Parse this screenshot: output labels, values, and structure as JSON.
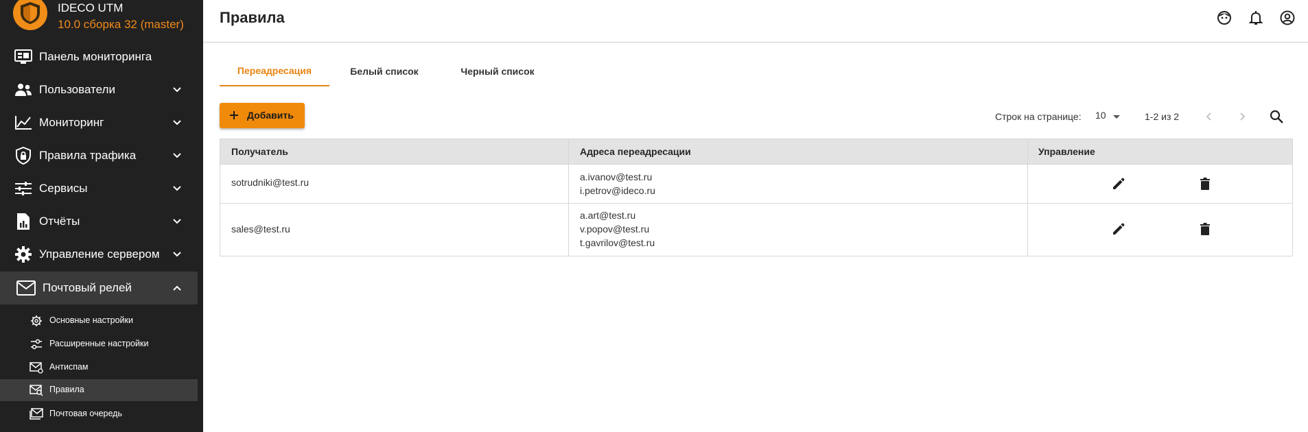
{
  "brand": {
    "name": "IDECO UTM",
    "version": "10.0 сборка 32 (master)"
  },
  "sidebar": {
    "items": [
      {
        "label": "Панель мониторинга",
        "icon": "monitor-dashboard-icon"
      },
      {
        "label": "Пользователи",
        "icon": "users-icon"
      },
      {
        "label": "Мониторинг",
        "icon": "chart-line-icon"
      },
      {
        "label": "Правила трафика",
        "icon": "shield-lock-icon"
      },
      {
        "label": "Сервисы",
        "icon": "sliders-icon"
      },
      {
        "label": "Отчёты",
        "icon": "report-icon"
      },
      {
        "label": "Управление сервером",
        "icon": "gear-icon"
      },
      {
        "label": "Почтовый релей",
        "icon": "mail-icon"
      }
    ],
    "subitems": [
      {
        "label": "Основные настройки",
        "icon": "gear-icon"
      },
      {
        "label": "Расширенные настройки",
        "icon": "sliders-icon"
      },
      {
        "label": "Антиспам",
        "icon": "mail-block-icon"
      },
      {
        "label": "Правила",
        "icon": "mail-search-icon"
      },
      {
        "label": "Почтовая очередь",
        "icon": "mail-queue-icon"
      }
    ]
  },
  "header": {
    "title": "Правила"
  },
  "tabs": [
    {
      "label": "Переадресация",
      "active": true
    },
    {
      "label": "Белый список",
      "active": false
    },
    {
      "label": "Черный список",
      "active": false
    }
  ],
  "toolbar": {
    "add_label": "Добавить",
    "rows_per_page_label": "Строк на странице:",
    "rows_per_page_value": "10",
    "range": "1-2 из 2"
  },
  "table": {
    "columns": [
      "Получатель",
      "Адреса переадресации",
      "Управление"
    ],
    "rows": [
      {
        "recipient": "sotrudniki@test.ru",
        "addresses": [
          "a.ivanov@test.ru",
          "i.petrov@ideco.ru"
        ]
      },
      {
        "recipient": "sales@test.ru",
        "addresses": [
          "a.art@test.ru",
          "v.popov@test.ru",
          "t.gavrilov@test.ru"
        ]
      }
    ]
  },
  "colors": {
    "accent": "#f08a0b",
    "sidebar_bg": "#212121",
    "version_text": "#f0891a"
  }
}
